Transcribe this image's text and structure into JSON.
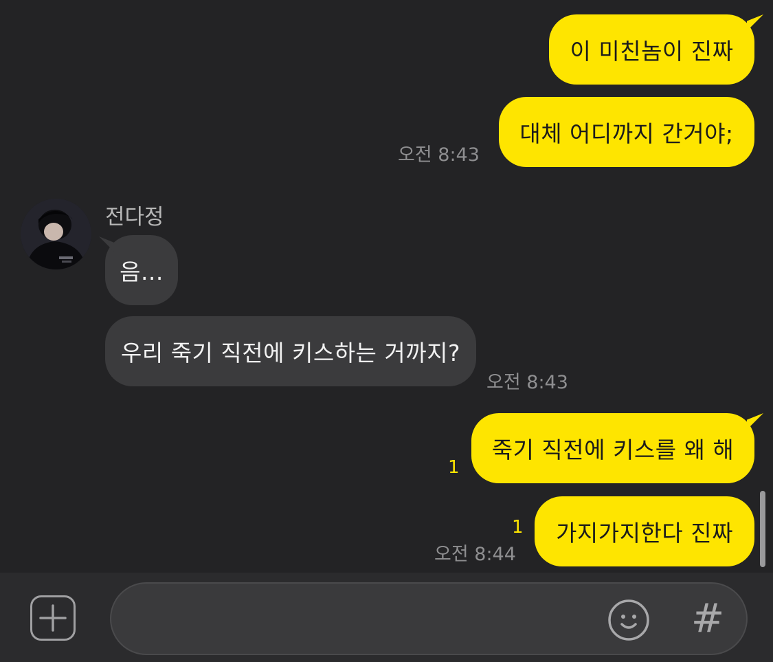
{
  "messages": [
    {
      "sender": "me",
      "text": "이 미친놈이 진짜"
    },
    {
      "sender": "me",
      "text": "대체 어디까지 간거야;",
      "time": "오전 8:43"
    },
    {
      "sender": "other",
      "name": "전다정",
      "text": "음..."
    },
    {
      "sender": "other",
      "text": "우리 죽기 직전에 키스하는 거까지?",
      "time": "오전 8:43"
    },
    {
      "sender": "me",
      "text": "죽기 직전에 키스를 왜 해",
      "unread": "1"
    },
    {
      "sender": "me",
      "text": "가지가지한다 진짜",
      "unread": "1",
      "time": "오전 8:44"
    }
  ],
  "input": {
    "placeholder": "",
    "icons": [
      "plus-icon",
      "emoji-icon",
      "hashtag-icon"
    ],
    "hash_symbol": "#"
  },
  "colors": {
    "background": "#232325",
    "my_bubble": "#fee500",
    "other_bubble": "#3b3b3d",
    "unread": "#fee500",
    "timestamp": "#8e8e90"
  }
}
